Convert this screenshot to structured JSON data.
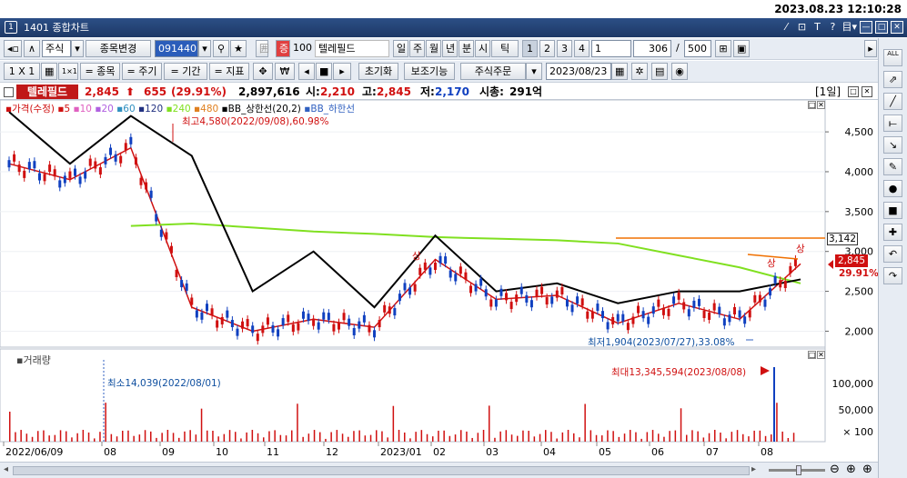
{
  "clock": "2023.08.23 12:10:28",
  "window": {
    "number": "1",
    "title": "1401 종합차트"
  },
  "title_buttons": [
    "⁄",
    "⊡",
    "T",
    "?",
    "目▾",
    "—",
    "□",
    "✕"
  ],
  "toolbar1": {
    "nav_left": "◂▫",
    "up": "∧",
    "market": "주식",
    "market_arrow": "▾",
    "change_item": "종목변경",
    "code": "091440",
    "code_arrow": "▾",
    "search": "⚲",
    "fav": "★",
    "lock": "囲",
    "badge": "증",
    "badge_num": "100",
    "name": "텔레필드",
    "periods": [
      "일",
      "주",
      "월",
      "년",
      "분",
      "시",
      "틱"
    ],
    "nums": [
      "1",
      "2",
      "3",
      "4",
      "1"
    ],
    "count": "306",
    "slash": "/",
    "max": "500"
  },
  "toolbar2": {
    "ratio": "1 X 1",
    "grid_icon": "▦",
    "one_icon": "1×1",
    "items": [
      "= 종목",
      "= 주기",
      "= 기간",
      "= 지표"
    ],
    "reset": "초기화",
    "aux": "보조기능",
    "order": "주식주문",
    "date": "2023/08/23"
  },
  "info": {
    "name": "텔레필드",
    "price": "2,845",
    "arrow": "⬆",
    "change": "655",
    "pct": "(29.91%)",
    "volume": "2,897,616",
    "open_label": "시:",
    "open": "2,210",
    "high_label": "고:",
    "high": "2,845",
    "low_label": "저:",
    "low": "2,170",
    "cap_label": "시총:",
    "cap": "291억",
    "period": "[1일]"
  },
  "legend": [
    {
      "label": "가격(수정)",
      "color": "#d01010"
    },
    {
      "label": "5",
      "color": "#d01010"
    },
    {
      "label": "10",
      "color": "#e060c0"
    },
    {
      "label": "20",
      "color": "#b060e0"
    },
    {
      "label": "60",
      "color": "#3090c0"
    },
    {
      "label": "120",
      "color": "#203080"
    },
    {
      "label": "240",
      "color": "#80e020"
    },
    {
      "label": "480",
      "color": "#e08020"
    },
    {
      "label": "BB_상한선(20,2)",
      "color": "#000000"
    },
    {
      "label": "BB_하한선",
      "color": "#3060c0"
    }
  ],
  "annotations": {
    "max_price": "최고4,580(2022/09/08),60.98%",
    "min_price": "최저1,904(2023/07/27),33.08%",
    "min_vol": "최소14,039(2022/08/01)",
    "max_vol": "최대13,345,594(2023/08/08)",
    "upper1": "상",
    "upper2": "상",
    "upper3": "상",
    "level_label": "3,142",
    "last_price": "2,845",
    "last_pct": "29.91%",
    "volume_title": "거래량"
  },
  "price_axis": [
    "4,500",
    "4,000",
    "3,500",
    "3,000",
    "2,500",
    "2,000"
  ],
  "volume_axis": [
    "100,000",
    "50,000",
    "× 100"
  ],
  "x_axis": [
    "2022/06/09",
    "08",
    "09",
    "10",
    "11",
    "12",
    "2023/01",
    "02",
    "03",
    "04",
    "05",
    "06",
    "07",
    "08"
  ],
  "right_tools": [
    "ALL",
    "⇗",
    "╱",
    "⟝",
    "↘",
    "✎",
    "●",
    "■",
    "✚",
    "↶",
    "↷"
  ],
  "zoom": [
    "⊖",
    "⊕",
    "⊕"
  ],
  "chart_data": {
    "type": "line",
    "title": "텔레필드 일봉",
    "x": [
      "2022/06",
      "2022/08",
      "2022/09",
      "2022/10",
      "2022/11",
      "2022/12",
      "2023/01",
      "2023/02",
      "2023/03",
      "2023/04",
      "2023/05",
      "2023/06",
      "2023/07",
      "2023/08"
    ],
    "series": [
      {
        "name": "가격(수정)",
        "values": [
          4100,
          3900,
          4300,
          2300,
          2000,
          2150,
          2050,
          2900,
          2400,
          2450,
          2100,
          2350,
          2150,
          2845
        ]
      },
      {
        "name": "240",
        "values": [
          null,
          null,
          3320,
          3350,
          3300,
          3250,
          3220,
          3180,
          3160,
          3140,
          3100,
          2950,
          2800,
          2600
        ]
      },
      {
        "name": "BB_상한선(20,2)",
        "values": [
          4750,
          4100,
          4700,
          4200,
          2500,
          3000,
          2300,
          3200,
          2500,
          2600,
          2350,
          2500,
          2500,
          2650
        ]
      }
    ],
    "ylim": [
      1800,
      4900
    ]
  }
}
